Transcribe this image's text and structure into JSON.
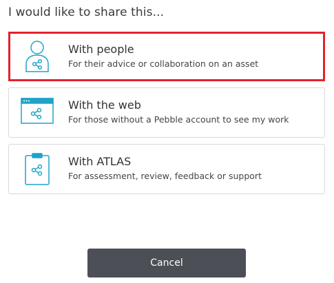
{
  "dialog": {
    "title": "I would like to share this..."
  },
  "options": [
    {
      "label": "With people",
      "description": "For their advice or collaboration on an asset",
      "icon": "person-share-icon",
      "selected": true
    },
    {
      "label": "With the web",
      "description": "For those without a Pebble account to see my work",
      "icon": "browser-share-icon",
      "selected": false
    },
    {
      "label": "With ATLAS",
      "description": "For assessment, review, feedback or support",
      "icon": "clipboard-share-icon",
      "selected": false
    }
  ],
  "actions": {
    "cancel_label": "Cancel"
  },
  "colors": {
    "icon": "#1fa3c9",
    "selected_border": "#e3212a",
    "cancel_bg": "#4c4f55"
  }
}
